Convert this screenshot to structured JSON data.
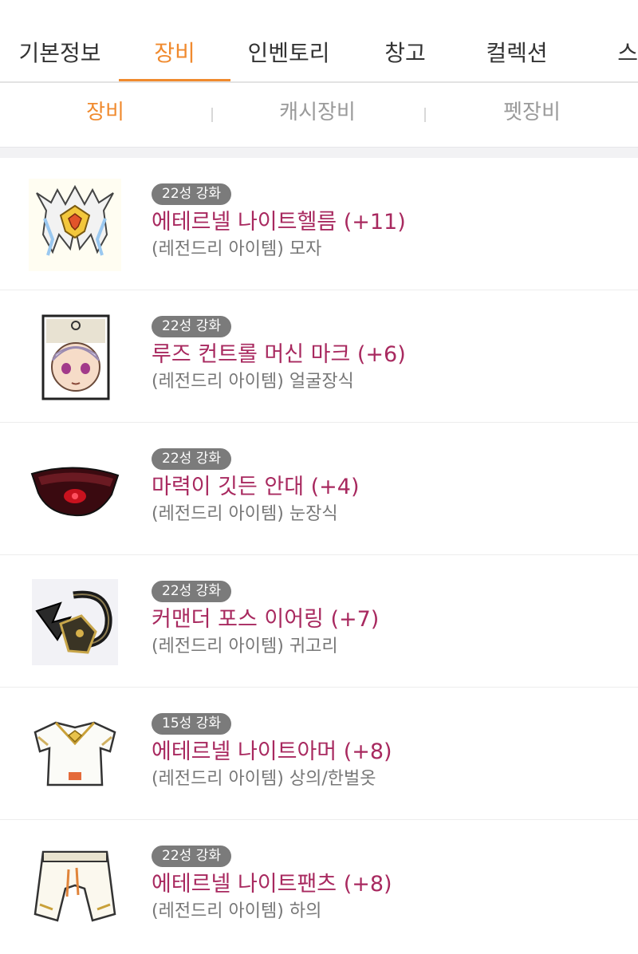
{
  "tabs": {
    "items": [
      "기본정보",
      "장비",
      "인벤토리",
      "창고",
      "컬렉션",
      "스킬"
    ],
    "active_index": 1
  },
  "subtabs": {
    "items": [
      "장비",
      "캐시장비",
      "펫장비"
    ],
    "active_index": 0
  },
  "items": [
    {
      "badge": "22성 강화",
      "name": "에테르넬 나이트헬름 (+11)",
      "type": "(레전드리 아이템) 모자",
      "icon": "helmet-icon"
    },
    {
      "badge": "22성 강화",
      "name": "루즈 컨트롤 머신 마크 (+6)",
      "type": "(레전드리 아이템) 얼굴장식",
      "icon": "face-mark-icon"
    },
    {
      "badge": "22성 강화",
      "name": "마력이 깃든 안대 (+4)",
      "type": "(레전드리 아이템) 눈장식",
      "icon": "eyepatch-icon"
    },
    {
      "badge": "22성 강화",
      "name": "커맨더 포스 이어링 (+7)",
      "type": "(레전드리 아이템) 귀고리",
      "icon": "earring-icon"
    },
    {
      "badge": "15성 강화",
      "name": "에테르넬 나이트아머 (+8)",
      "type": "(레전드리 아이템) 상의/한벌옷",
      "icon": "armor-icon"
    },
    {
      "badge": "22성 강화",
      "name": "에테르넬 나이트팬츠 (+8)",
      "type": "(레전드리 아이템) 하의",
      "icon": "pants-icon"
    }
  ]
}
